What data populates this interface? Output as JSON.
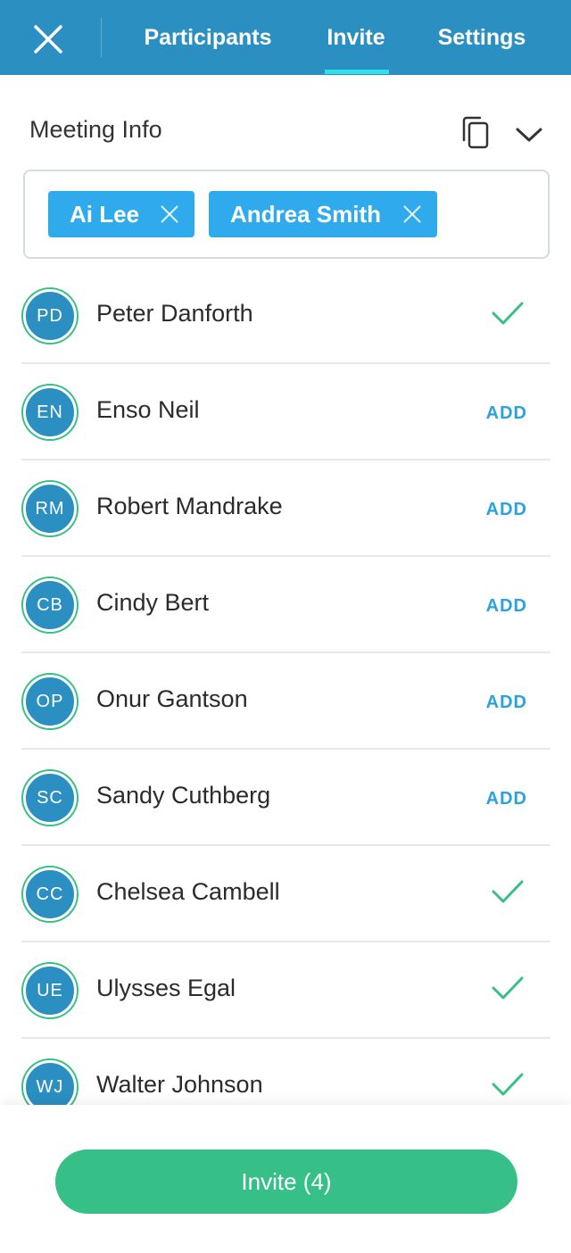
{
  "header": {
    "tabs": [
      {
        "label": "Participants"
      },
      {
        "label": "Invite"
      },
      {
        "label": "Settings"
      }
    ]
  },
  "meeting": {
    "title": "Meeting Info"
  },
  "selected": [
    {
      "name": "Ai Lee"
    },
    {
      "name": "Andrea Smith"
    }
  ],
  "contacts": [
    {
      "initials": "PD",
      "name": "Peter Danforth",
      "status": "added"
    },
    {
      "initials": "EN",
      "name": "Enso Neil",
      "status": "add",
      "action": "ADD"
    },
    {
      "initials": "RM",
      "name": "Robert Mandrake",
      "status": "add",
      "action": "ADD"
    },
    {
      "initials": "CB",
      "name": "Cindy Bert",
      "status": "add",
      "action": "ADD"
    },
    {
      "initials": "OP",
      "name": "Onur Gantson",
      "status": "add",
      "action": "ADD"
    },
    {
      "initials": "SC",
      "name": "Sandy Cuthberg",
      "status": "add",
      "action": "ADD"
    },
    {
      "initials": "CC",
      "name": "Chelsea Cambell",
      "status": "added"
    },
    {
      "initials": "UE",
      "name": "Ulysses Egal",
      "status": "added"
    },
    {
      "initials": "WJ",
      "name": "Walter Johnson",
      "status": "added"
    }
  ],
  "footer": {
    "invite_label": "Invite (4)"
  },
  "colors": {
    "header_bg": "#2b8fc1",
    "tab_indicator": "#2ee0e8",
    "chip_bg": "#2eaaed",
    "accent_green": "#36bf86",
    "add_link": "#2aa2e0"
  }
}
